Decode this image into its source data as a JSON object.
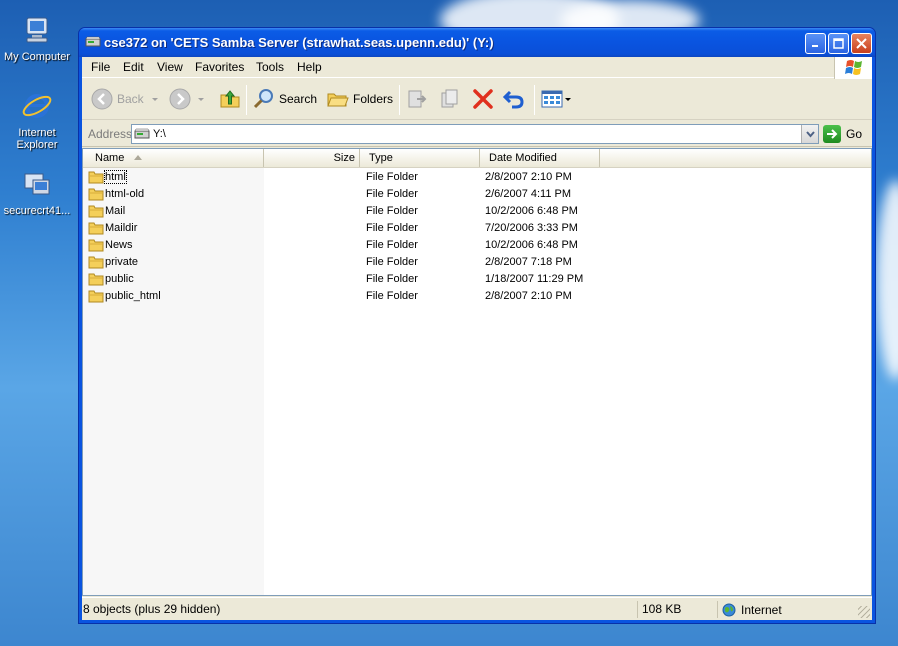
{
  "desktop": {
    "icons": [
      {
        "label": "My Computer"
      },
      {
        "label": "Internet Explorer"
      },
      {
        "label": "securecrt41..."
      }
    ]
  },
  "window": {
    "title": "cse372 on 'CETS Samba Server (strawhat.seas.upenn.edu)' (Y:)"
  },
  "menu": [
    {
      "label": "File"
    },
    {
      "label": "Edit"
    },
    {
      "label": "View"
    },
    {
      "label": "Favorites"
    },
    {
      "label": "Tools"
    },
    {
      "label": "Help"
    }
  ],
  "toolbar": {
    "back": "Back",
    "search": "Search",
    "folders": "Folders"
  },
  "address": {
    "label": "Address",
    "value": "Y:\\",
    "go": "Go"
  },
  "columns": {
    "name": "Name",
    "size": "Size",
    "type": "Type",
    "date": "Date Modified"
  },
  "files": [
    {
      "name": "html",
      "size": "",
      "type": "File Folder",
      "date": "2/8/2007 2:10 PM"
    },
    {
      "name": "html-old",
      "size": "",
      "type": "File Folder",
      "date": "2/6/2007 4:11 PM"
    },
    {
      "name": "Mail",
      "size": "",
      "type": "File Folder",
      "date": "10/2/2006 6:48 PM"
    },
    {
      "name": "Maildir",
      "size": "",
      "type": "File Folder",
      "date": "7/20/2006 3:33 PM"
    },
    {
      "name": "News",
      "size": "",
      "type": "File Folder",
      "date": "10/2/2006 6:48 PM"
    },
    {
      "name": "private",
      "size": "",
      "type": "File Folder",
      "date": "2/8/2007 7:18 PM"
    },
    {
      "name": "public",
      "size": "",
      "type": "File Folder",
      "date": "1/18/2007 11:29 PM"
    },
    {
      "name": "public_html",
      "size": "",
      "type": "File Folder",
      "date": "2/8/2007 2:10 PM"
    }
  ],
  "status": {
    "objects": "8 objects (plus 29 hidden)",
    "size": "108 KB",
    "zone": "Internet"
  },
  "colors": {
    "titlebar": "#0a54e0",
    "folder": "#f4cf5a",
    "delete": "#e0301e"
  }
}
